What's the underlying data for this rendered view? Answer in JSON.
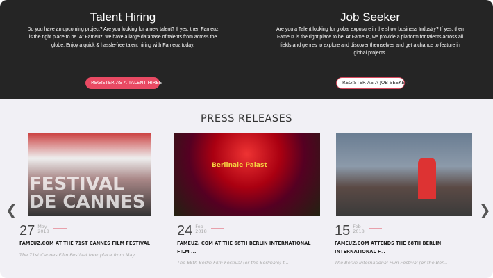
{
  "talent": {
    "title": "Talent Hiring",
    "text": "Do you have an upcoming project? Are you looking for a new talent? If yes, then Fameuz is the right place to be. At Fameuz, we have a large database of talents from across the globe. Enjoy a quick & hassle-free talent hiring with Fameuz today.",
    "button": "REGISTER AS A TALENT HIREE"
  },
  "seeker": {
    "title": "Job Seeker",
    "text": "Are you a Talent looking for global exposure in the show business Industry? If yes, then Fameuz is the right place to be. At Fameuz, we provide a platform for talents across all fields and genres to explore and discover themselves and get a chance to feature in global projects.",
    "button": "REGISTER AS A JOB SEEKER"
  },
  "press": {
    "title": "PRESS RELEASES",
    "prev_icon": "chevron-left",
    "next_icon": "chevron-right",
    "items": [
      {
        "day": "27",
        "month": "May",
        "year": "2018",
        "title": "FAMEUZ.COM AT THE 71ST CANNES FILM FESTIVAL",
        "excerpt": "The 71st Cannes Film Festival took place from May ...",
        "image_text": "FESTIVAL DE CANNES"
      },
      {
        "day": "24",
        "month": "Feb",
        "year": "2018",
        "title": "FAMEUZ. COM AT THE 68TH BERLIN INTERNATIONAL FILM ...",
        "excerpt": "The 68th Berlin Film Festival (or the Berlinale) t...",
        "image_text": "Berlinale Palast"
      },
      {
        "day": "15",
        "month": "Feb",
        "year": "2018",
        "title": "FAMEUZ.COM ATTENDS THE 68TH BERLIN INTERNATIONAL F...",
        "excerpt": "The Berlin International Film Festival (or the Ber..."
      }
    ]
  },
  "colors": {
    "dark": "#252525",
    "accent": "#e94a63",
    "light": "#f1f0f5"
  }
}
